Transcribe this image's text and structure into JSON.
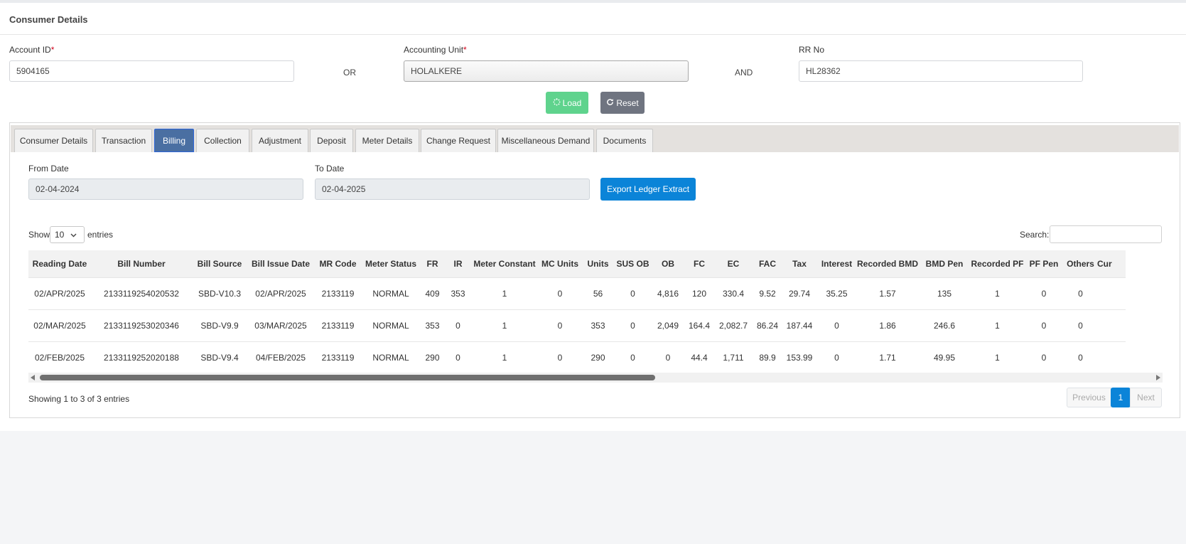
{
  "header": {
    "title": "Consumer Details"
  },
  "form": {
    "account_id_label": "Account ID",
    "account_id_value": "5904165",
    "or_text": "OR",
    "accounting_unit_label": "Accounting Unit",
    "accounting_unit_value": "HOLALKERE",
    "and_text": "AND",
    "rr_no_label": "RR No",
    "rr_no_value": "HL28362",
    "required_mark": "*",
    "load_label": "Load",
    "reset_label": "Reset"
  },
  "tabs": [
    {
      "label": "Consumer Details"
    },
    {
      "label": "Transaction"
    },
    {
      "label": "Billing",
      "active": true
    },
    {
      "label": "Collection"
    },
    {
      "label": "Adjustment"
    },
    {
      "label": "Deposit"
    },
    {
      "label": "Meter Details"
    },
    {
      "label": "Change Request"
    },
    {
      "label": "Miscellaneous Demand"
    },
    {
      "label": "Documents"
    }
  ],
  "billing": {
    "from_date_label": "From Date",
    "from_date_value": "02-04-2024",
    "to_date_label": "To Date",
    "to_date_value": "02-04-2025",
    "export_label": "Export Ledger Extract",
    "show_label": "Show",
    "entries_label": "entries",
    "page_length": "10",
    "search_label": "Search:",
    "columns": [
      "Reading Date",
      "Bill Number",
      "Bill Source",
      "Bill Issue Date",
      "MR Code",
      "Meter Status",
      "FR",
      "IR",
      "Meter Constant",
      "MC Units",
      "Units",
      "SUS OB",
      "OB",
      "FC",
      "EC",
      "FAC",
      "Tax",
      "Interest",
      "Recorded BMD",
      "BMD Pen",
      "Recorded PF",
      "PF Pen",
      "Others",
      "Cur"
    ],
    "rows": [
      [
        "02/APR/2025",
        "2133119254020532",
        "SBD-V10.3",
        "02/APR/2025",
        "2133119",
        "NORMAL",
        "409",
        "353",
        "1",
        "0",
        "56",
        "0",
        "4,816",
        "120",
        "330.4",
        "9.52",
        "29.74",
        "35.25",
        "1.57",
        "135",
        "1",
        "0",
        "0",
        ""
      ],
      [
        "02/MAR/2025",
        "2133119253020346",
        "SBD-V9.9",
        "03/MAR/2025",
        "2133119",
        "NORMAL",
        "353",
        "0",
        "1",
        "0",
        "353",
        "0",
        "2,049",
        "164.4",
        "2,082.7",
        "86.24",
        "187.44",
        "0",
        "1.86",
        "246.6",
        "1",
        "0",
        "0",
        ""
      ],
      [
        "02/FEB/2025",
        "2133119252020188",
        "SBD-V9.4",
        "04/FEB/2025",
        "2133119",
        "NORMAL",
        "290",
        "0",
        "1",
        "0",
        "290",
        "0",
        "0",
        "44.4",
        "1,711",
        "89.9",
        "153.99",
        "0",
        "1.71",
        "49.95",
        "1",
        "0",
        "0",
        ""
      ]
    ],
    "info": "Showing 1 to 3 of 3 entries",
    "pagination": {
      "previous": "Previous",
      "current": "1",
      "next": "Next"
    }
  }
}
